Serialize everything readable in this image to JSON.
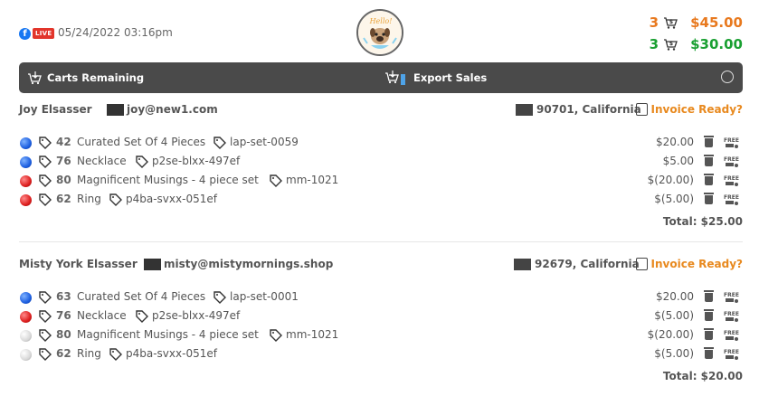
{
  "header": {
    "fb_icon": "facebook-icon",
    "live_label": "LIVE",
    "datetime": "05/24/2022 03:16pm",
    "logo_text": "Hello!",
    "stats": [
      {
        "count": "3",
        "icon": "cart-dollar-icon",
        "amount": "$45.00",
        "color": "#e8791e"
      },
      {
        "count": "3",
        "icon": "cart-dollar-icon",
        "amount": "$30.00",
        "color": "#1aa032"
      }
    ]
  },
  "toolbar": {
    "carts_label": "Carts Remaining",
    "export_label": "Export Sales",
    "bar_color": "#4a4a4a"
  },
  "customers": [
    {
      "name": "Joy Elsasser",
      "email": "joy@new1.com",
      "zip": "90701, California",
      "invoice": "Invoice Ready?",
      "items": [
        {
          "dot": "blue",
          "num": "42",
          "title": "Curated Set Of 4 Pieces",
          "sku": "lap-set-0059",
          "price": "$20.00"
        },
        {
          "dot": "blue",
          "num": "76",
          "title": "Necklace",
          "sku": "p2se-blxx-497ef",
          "price": "$5.00"
        },
        {
          "dot": "red",
          "num": "80",
          "title": "Magnificent Musings - 4 piece set",
          "sku": "mm-1021",
          "price": "$(20.00)"
        },
        {
          "dot": "red",
          "num": "62",
          "title": "Ring",
          "sku": "p4ba-svxx-051ef",
          "price": "$(5.00)"
        }
      ],
      "total": "Total: $25.00"
    },
    {
      "name": "Misty York Elsasser",
      "email": "misty@mistymornings.shop",
      "zip": "92679, California",
      "invoice": "Invoice Ready?",
      "items": [
        {
          "dot": "blue",
          "num": "63",
          "title": "Curated Set Of 4 Pieces",
          "sku": "lap-set-0001",
          "price": "$20.00"
        },
        {
          "dot": "red",
          "num": "76",
          "title": "Necklace",
          "sku": "p2se-blxx-497ef",
          "price": "$(5.00)"
        },
        {
          "dot": "white",
          "num": "80",
          "title": "Magnificent Musings - 4 piece set",
          "sku": "mm-1021",
          "price": "$(20.00)"
        },
        {
          "dot": "white",
          "num": "62",
          "title": "Ring",
          "sku": "p4ba-svxx-051ef",
          "price": "$(5.00)"
        }
      ],
      "total": "Total: $20.00"
    }
  ]
}
